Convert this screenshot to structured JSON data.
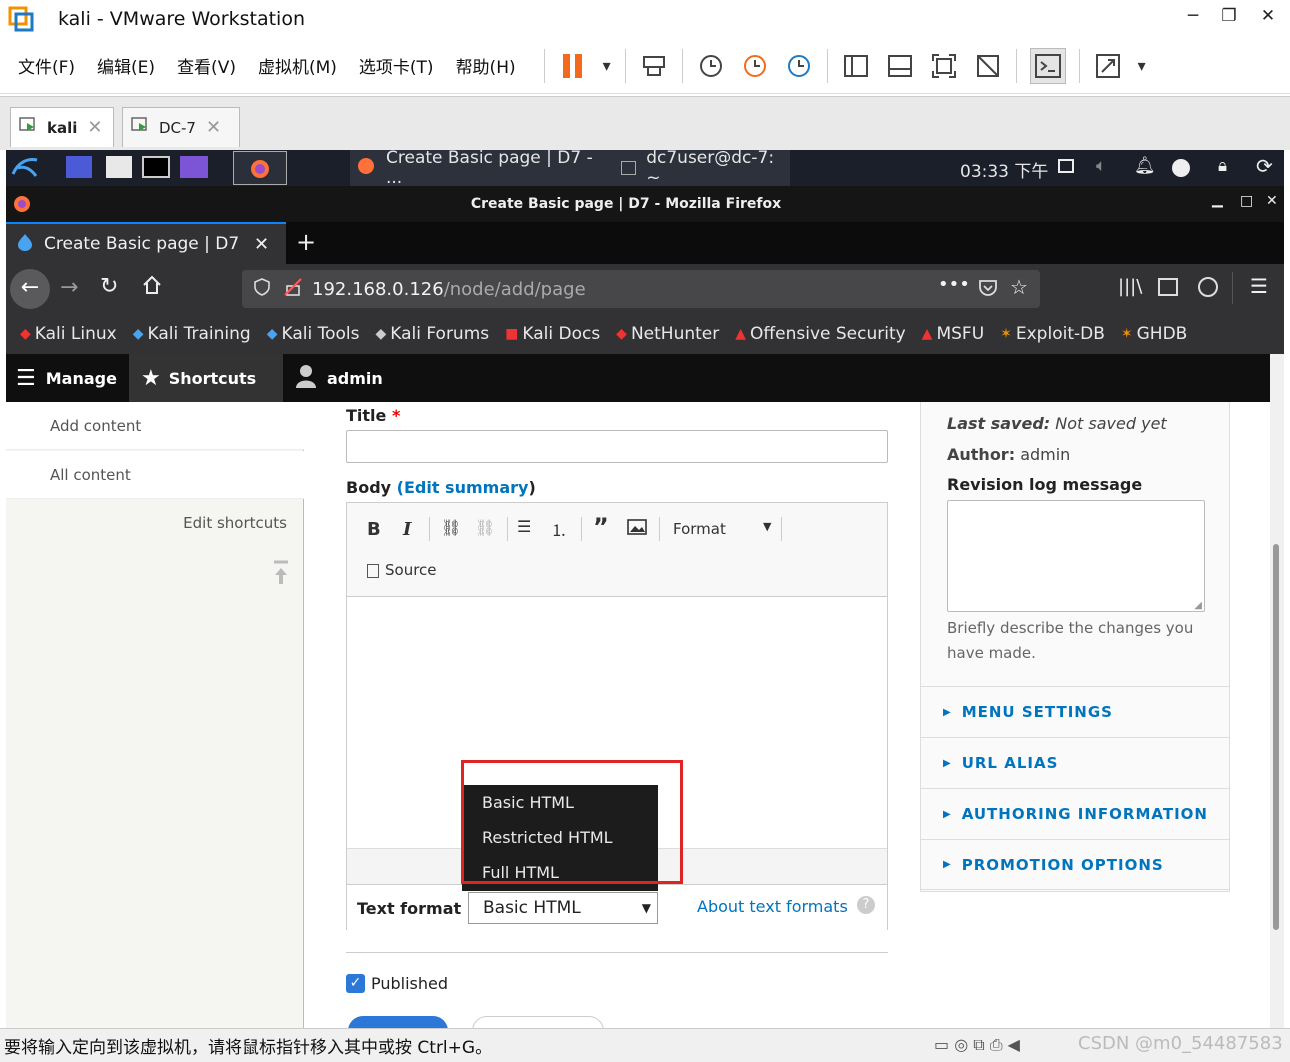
{
  "vmware": {
    "title": "kali - VMware Workstation",
    "menu": [
      "文件(F)",
      "编辑(E)",
      "查看(V)",
      "虚拟机(M)",
      "选项卡(T)",
      "帮助(H)"
    ],
    "tabs": [
      {
        "label": "kali"
      },
      {
        "label": "DC-7"
      }
    ],
    "status_text": "要将输入定向到该虚拟机，请将鼠标指针移入其中或按 Ctrl+G。",
    "watermark": "CSDN @m0_54487583"
  },
  "kali_panel": {
    "task1": "Create Basic page | D7 - ...",
    "task2": "dc7user@dc-7: ~",
    "clock": "03:33 下午"
  },
  "firefox": {
    "window_title": "Create Basic page | D7 - Mozilla Firefox",
    "tab_title": "Create Basic page | D7",
    "url_host": "192.168.0.126",
    "url_path": "/node/add/page",
    "bookmarks": [
      "Kali Linux",
      "Kali Training",
      "Kali Tools",
      "Kali Forums",
      "Kali Docs",
      "NetHunter",
      "Offensive Security",
      "MSFU",
      "Exploit-DB",
      "GHDB"
    ]
  },
  "drupal_toolbar": {
    "manage": "Manage",
    "shortcuts": "Shortcuts",
    "user": "admin"
  },
  "sidebar": {
    "items": [
      "Add content",
      "All content"
    ],
    "edit_shortcuts": "Edit shortcuts"
  },
  "form": {
    "title_label": "Title",
    "title_required": "*",
    "body_label": "Body",
    "edit_summary_open": "(",
    "edit_summary": "Edit summary",
    "edit_summary_close": ")",
    "format_dropdown": "Format",
    "source_label": "Source",
    "text_format_label": "Text format",
    "text_format_value": "Basic HTML",
    "text_format_options": [
      "Basic HTML",
      "Restricted HTML",
      "Full HTML"
    ],
    "about_text_formats": "About text formats",
    "published_label": "Published"
  },
  "meta": {
    "last_saved_label": "Last saved:",
    "last_saved_value": "Not saved yet",
    "author_label": "Author:",
    "author_value": "admin",
    "revision_label": "Revision log message",
    "revision_help": "Briefly describe the changes you have made.",
    "sections": [
      "MENU SETTINGS",
      "URL ALIAS",
      "AUTHORING INFORMATION",
      "PROMOTION OPTIONS"
    ]
  },
  "colors": {
    "drupal_link": "#0074bd",
    "highlight_red": "#e02424",
    "firefox_dark": "#323234"
  }
}
